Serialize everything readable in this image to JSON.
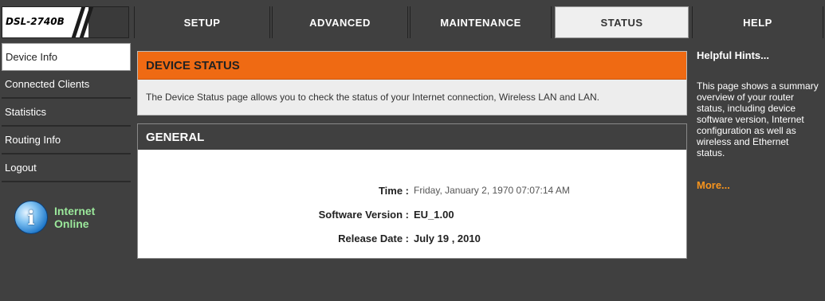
{
  "model": "DSL-2740B",
  "nav": {
    "tabs": [
      {
        "label": "SETUP",
        "active": false
      },
      {
        "label": "ADVANCED",
        "active": false
      },
      {
        "label": "MAINTENANCE",
        "active": false
      },
      {
        "label": "STATUS",
        "active": true
      },
      {
        "label": "HELP",
        "active": false
      }
    ]
  },
  "sidebar": {
    "items": [
      {
        "label": "Device Info",
        "active": true
      },
      {
        "label": "Connected Clients",
        "active": false
      },
      {
        "label": "Statistics",
        "active": false
      },
      {
        "label": "Routing Info",
        "active": false
      },
      {
        "label": "Logout",
        "active": false
      }
    ],
    "internet_status": {
      "line1": "Internet",
      "line2": "Online",
      "icon": "info-globe-icon"
    }
  },
  "device_status": {
    "title": "DEVICE STATUS",
    "description": "The Device Status page allows you to check the status of your Internet connection, Wireless LAN and LAN."
  },
  "general": {
    "title": "GENERAL",
    "rows": [
      {
        "label": "Time :",
        "value": "Friday, January 2, 1970 07:07:14 AM"
      },
      {
        "label": "Software Version :",
        "value": "EU_1.00"
      },
      {
        "label": "Release Date :",
        "value": "July 19 , 2010"
      }
    ]
  },
  "hints": {
    "title": "Helpful Hints...",
    "text": "This page shows a summary overview of your router status, including device software version, Internet configuration as well as wireless and Ethernet status.",
    "more": "More..."
  },
  "colors": {
    "orange_header": "#ef6a13",
    "dark_bg": "#404040",
    "more_link": "#f7941d",
    "online_text": "#9be89b"
  }
}
